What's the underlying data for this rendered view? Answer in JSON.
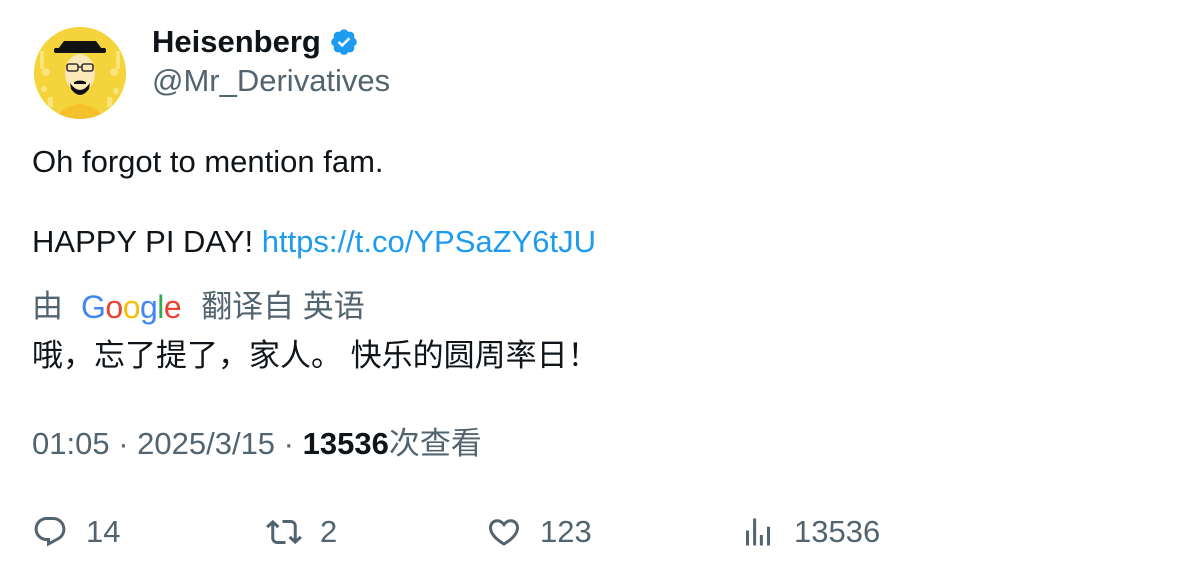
{
  "author": {
    "display_name": "Heisenberg",
    "handle": "@Mr_Derivatives",
    "verified": true,
    "avatar_icon": "heisenberg-avatar-icon"
  },
  "tweet": {
    "line1": "Oh forgot to mention fam.",
    "line2_text": "HAPPY PI DAY! ",
    "link": "https://t.co/YPSaZY6tJU"
  },
  "translation": {
    "prefix": "由",
    "provider_letters": [
      "G",
      "o",
      "o",
      "g",
      "l",
      "e"
    ],
    "suffix": "翻译自 英语",
    "text": "哦，忘了提了，家人。 快乐的圆周率日！"
  },
  "meta": {
    "time": "01:05",
    "separator": " · ",
    "date": "2025/3/15",
    "views": "13536",
    "views_label": "次查看"
  },
  "actions": {
    "replies": "14",
    "retweets": "2",
    "likes": "123",
    "views": "13536"
  },
  "colors": {
    "link": "#1d9bf0",
    "secondary_text": "#536471",
    "verified_badge": "#1d9bf0"
  }
}
